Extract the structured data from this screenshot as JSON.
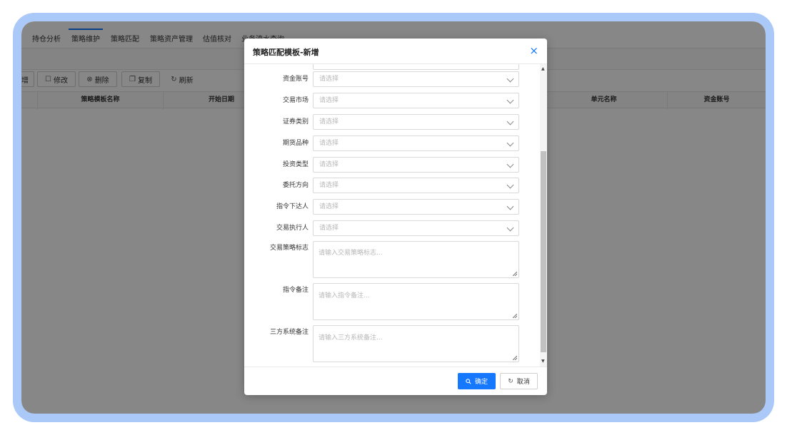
{
  "tabs": [
    {
      "label": "持仓分析"
    },
    {
      "label": "策略维护",
      "active": true
    },
    {
      "label": "策略匹配"
    },
    {
      "label": "策略资产管理"
    },
    {
      "label": "估值核对"
    },
    {
      "label": "业务流水查询"
    }
  ],
  "toolbar": {
    "add_label": "增",
    "edit_label": "修改",
    "delete_label": "删除",
    "copy_label": "复制",
    "refresh_label": "刷新"
  },
  "grid": {
    "columns": [
      "策略模板名称",
      "开始日期",
      "单元名称",
      "资金账号"
    ]
  },
  "modal": {
    "title": "策略匹配模板-新增",
    "close": "×",
    "fields": [
      {
        "label": "资金账号",
        "placeholder": "请选择"
      },
      {
        "label": "交易市场",
        "placeholder": "请选择"
      },
      {
        "label": "证券类别",
        "placeholder": "请选择"
      },
      {
        "label": "期货品种",
        "placeholder": "请选择"
      },
      {
        "label": "投资类型",
        "placeholder": "请选择"
      },
      {
        "label": "委托方向",
        "placeholder": "请选择"
      },
      {
        "label": "指令下达人",
        "placeholder": "请选择"
      },
      {
        "label": "交易执行人",
        "placeholder": "请选择"
      }
    ],
    "textareas": [
      {
        "label": "交易策略标志",
        "placeholder": "请输入交易策略标志..."
      },
      {
        "label": "指令备注",
        "placeholder": "请输入指令备注..."
      },
      {
        "label": "三方系统备注",
        "placeholder": "请输入三方系统备注..."
      }
    ],
    "confirm_label": "确定",
    "cancel_label": "取消"
  },
  "icons": {
    "close": "close-icon",
    "confirm": "search-icon",
    "cancel": "refresh-icon"
  },
  "colors": {
    "primary": "#1677ff",
    "frame": "#aac8f8",
    "overlay": "rgba(0,0,0,0.47)"
  }
}
